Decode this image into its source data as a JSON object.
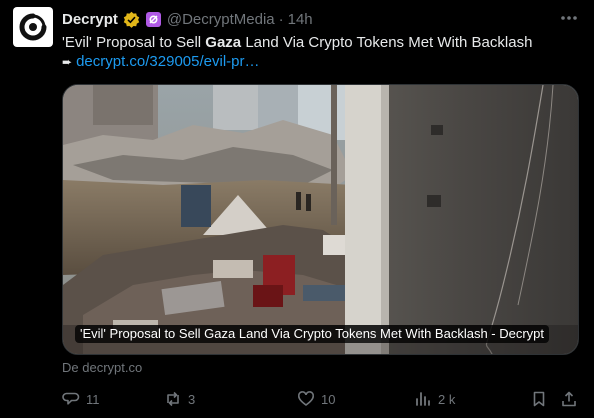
{
  "tweet": {
    "display_name": "Decrypt",
    "handle": "@DecryptMedia",
    "separator": "·",
    "time": "14h",
    "text_before": "'Evil' Proposal to Sell ",
    "text_bold": "Gaza",
    "text_after": " Land Via Crypto Tokens Met With Backlash",
    "arrow": "➨",
    "link": "decrypt.co/329005/evil-pr…",
    "card_caption": "'Evil' Proposal to Sell Gaza Land Via Crypto Tokens Met With Backlash - Decrypt",
    "source": "De decrypt.co"
  },
  "actions": {
    "replies": "11",
    "reposts": "3",
    "likes": "10",
    "views": "2 k"
  },
  "colors": {
    "background": "#000000",
    "text": "#e7e9ea",
    "muted": "#71767b",
    "link": "#1d9bf0",
    "verified": "#e2b719",
    "affiliate": "#b05ae6"
  },
  "icons": [
    "decrypt-logo-icon",
    "verified-badge-icon",
    "affiliate-badge-icon",
    "more-icon",
    "reply-icon",
    "repost-icon",
    "like-icon",
    "views-icon",
    "bookmark-icon",
    "share-icon"
  ]
}
